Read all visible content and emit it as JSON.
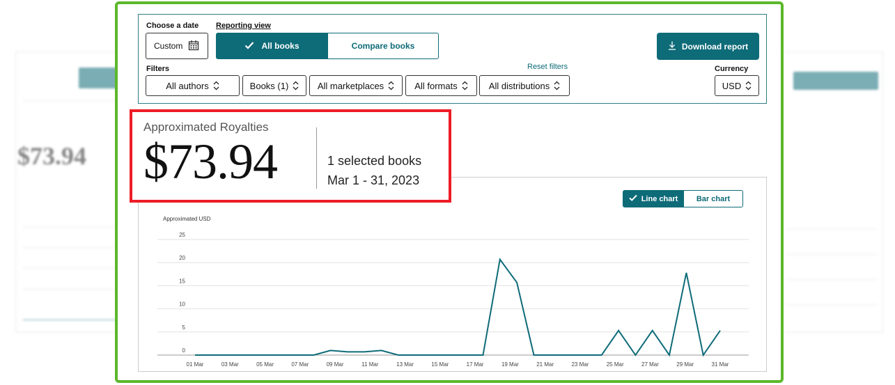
{
  "filters_panel": {
    "date_label": "Choose a date",
    "date_value": "Custom",
    "reporting_label": "Reporting view",
    "view_all": "All books",
    "view_compare": "Compare books",
    "download": "Download report",
    "filters_label": "Filters",
    "reset": "Reset filters",
    "currency_label": "Currency",
    "dropdowns": [
      "All authors",
      "Books (1)",
      "All marketplaces",
      "All formats",
      "All distributions"
    ],
    "currency": "USD"
  },
  "royalties": {
    "title": "Approximated Royalties",
    "amount": "$73.94",
    "books": "1 selected books",
    "dates": "Mar 1 - 31, 2023"
  },
  "chart_toggle": {
    "line": "Line chart",
    "bar": "Bar chart"
  },
  "colors": {
    "accent": "#0e6b78",
    "frame": "#5cb82a",
    "highlight": "#ee1c25"
  },
  "chart_data": {
    "type": "line",
    "ylabel": "Approximated USD",
    "ylim": [
      0,
      25
    ],
    "yticks": [
      0,
      5,
      10,
      15,
      20,
      25
    ],
    "x_tick_labels": [
      "01 Mar",
      "03 Mar",
      "05 Mar",
      "07 Mar",
      "09 Mar",
      "11 Mar",
      "13 Mar",
      "15 Mar",
      "17 Mar",
      "19 Mar",
      "21 Mar",
      "23 Mar",
      "25 Mar",
      "27 Mar",
      "29 Mar",
      "31 Mar"
    ],
    "x": [
      1,
      2,
      3,
      4,
      5,
      6,
      7,
      8,
      9,
      10,
      11,
      12,
      13,
      14,
      15,
      16,
      17,
      18,
      19,
      20,
      21,
      22,
      23,
      24,
      25,
      26,
      27,
      28,
      29,
      30,
      31
    ],
    "series": [
      {
        "values": [
          0,
          0,
          0,
          0,
          0,
          0,
          0,
          0,
          1.0,
          0.7,
          0.7,
          1.0,
          0,
          0,
          0,
          0,
          0,
          0,
          20.7,
          15.7,
          0,
          0,
          0,
          0,
          0,
          5.3,
          0,
          5.3,
          0,
          17.8,
          0,
          5.3
        ]
      }
    ],
    "grid": true,
    "legend": "none"
  }
}
